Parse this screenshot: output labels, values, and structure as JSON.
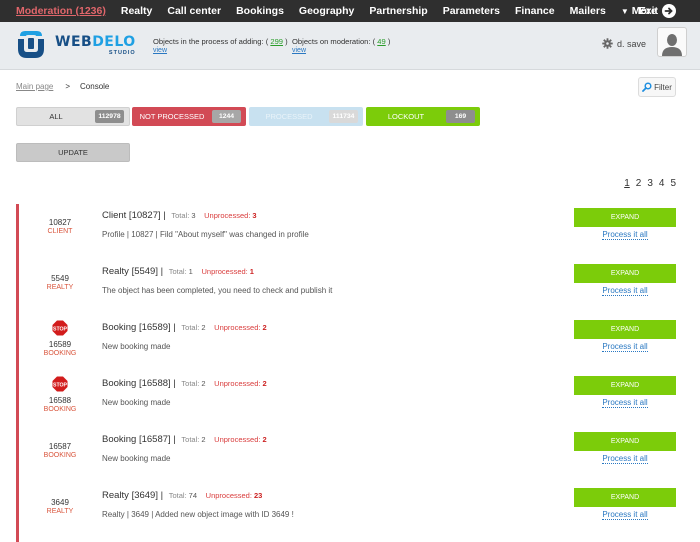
{
  "topnav": {
    "items": [
      {
        "label": "Moderation (1236)",
        "active": true
      },
      {
        "label": "Realty"
      },
      {
        "label": "Call center"
      },
      {
        "label": "Bookings"
      },
      {
        "label": "Geography"
      },
      {
        "label": "Partnership"
      },
      {
        "label": "Parameters"
      },
      {
        "label": "Finance"
      },
      {
        "label": "Mailers"
      },
      {
        "label": "More"
      }
    ],
    "exit_label": "Exit"
  },
  "header": {
    "logo": {
      "part1": "WEB",
      "part2": "DELO",
      "sub": "STUDIO"
    },
    "adding": {
      "label": "Objects in the process of adding: (",
      "count": "299",
      "close": ")",
      "view": "view"
    },
    "moderation": {
      "label": "Objects on moderation: (",
      "count": "49",
      "close": ")",
      "view": "view"
    },
    "user_name": "d. save"
  },
  "breadcrumb": {
    "home": "Main page",
    "separator": ">",
    "current": "Console"
  },
  "filter_label": "Filter",
  "tabs": {
    "all": {
      "label": "ALL",
      "count": "112978"
    },
    "not_processed": {
      "label": "NOT PROCESSED",
      "count": "1244"
    },
    "processed": {
      "label": "PROCESSED",
      "count": "111734"
    },
    "lockout": {
      "label": "LOCKOUT",
      "count": "169"
    }
  },
  "update_label": "UPDATE",
  "pagination": {
    "pages": [
      "1",
      "2",
      "3",
      "4",
      "5"
    ],
    "current": "1"
  },
  "colors": {
    "accent_red": "#d24a55",
    "accent_green": "#7ccc0a",
    "link_blue": "#2a78c2"
  },
  "list": {
    "total_label": "Total:",
    "unprocessed_label": "Unprocessed:",
    "expand_label": "EXPAND",
    "process_label": "Process it all",
    "rows": [
      {
        "id": "10827",
        "type": "CLIENT",
        "icon": "none",
        "title": "Client [10827] |",
        "total": "3",
        "unprocessed": "3",
        "desc": "Profile | 10827 | Fild \"About myself\" was changed in profile"
      },
      {
        "id": "5549",
        "type": "REALTY",
        "icon": "none",
        "title": "Realty [5549] |",
        "total": "1",
        "unprocessed": "1",
        "desc": "The object has been completed, you need to check and publish it"
      },
      {
        "id": "16589",
        "type": "BOOKING",
        "icon": "stop-sign",
        "title": "Booking [16589] |",
        "total": "2",
        "unprocessed": "2",
        "desc": "New booking made"
      },
      {
        "id": "16588",
        "type": "BOOKING",
        "icon": "stop-sign",
        "title": "Booking [16588] |",
        "total": "2",
        "unprocessed": "2",
        "desc": "New booking made"
      },
      {
        "id": "16587",
        "type": "BOOKING",
        "icon": "none",
        "title": "Booking [16587] |",
        "total": "2",
        "unprocessed": "2",
        "desc": "New booking made"
      },
      {
        "id": "3649",
        "type": "REALTY",
        "icon": "none",
        "title": "Realty [3649] |",
        "total": "74",
        "unprocessed": "23",
        "desc": "Realty | 3649 | Added new object image with ID 3649 !"
      }
    ]
  }
}
